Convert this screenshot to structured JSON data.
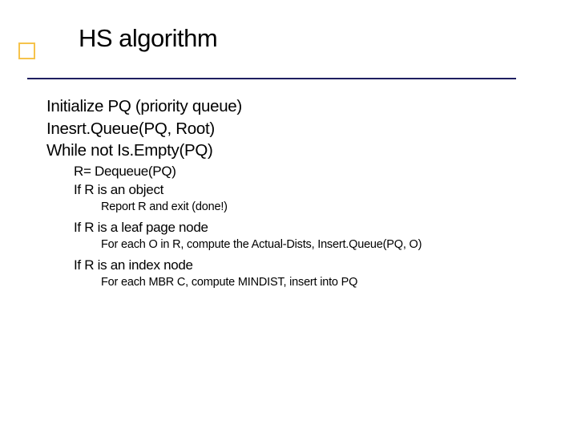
{
  "title": "HS algorithm",
  "lines": {
    "a1": "Initialize PQ (priority queue)",
    "a2": "Inesrt.Queue(PQ, Root)",
    "a3": "While not Is.Empty(PQ)",
    "b1": "R= Dequeue(PQ)",
    "b2": "If R is an object",
    "c1": "Report R and exit (done!)",
    "b3": "If R is a leaf page node",
    "c2": "For each O in R, compute the Actual-Dists, Insert.Queue(PQ, O)",
    "b4": "If R is an index node",
    "c3": "For each MBR C, compute MINDIST, insert into PQ"
  }
}
